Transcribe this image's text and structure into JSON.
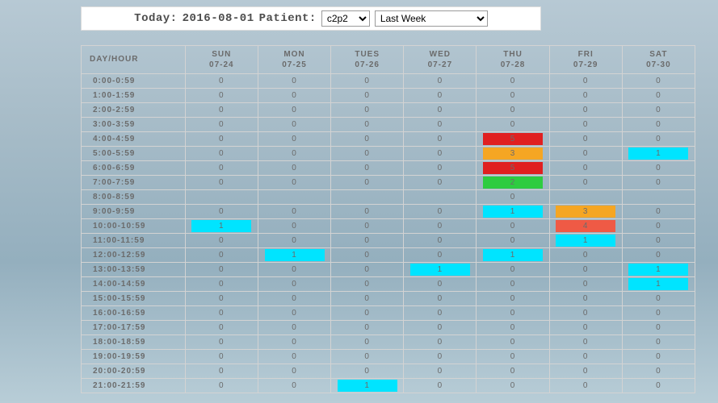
{
  "controlBar": {
    "todayLabel": "Today:",
    "todayDate": "2016-08-01",
    "patientLabel": "Patient:",
    "patientSelected": "c2p2",
    "rangeSelected": "Last Week"
  },
  "columns": {
    "hourHeader": "DAY/HOUR",
    "days": [
      {
        "name": "SUN",
        "date": "07-24"
      },
      {
        "name": "MON",
        "date": "07-25"
      },
      {
        "name": "TUES",
        "date": "07-26"
      },
      {
        "name": "WED",
        "date": "07-27"
      },
      {
        "name": "THU",
        "date": "07-28"
      },
      {
        "name": "FRI",
        "date": "07-29"
      },
      {
        "name": "SAT",
        "date": "07-30"
      }
    ]
  },
  "rows": [
    {
      "label": "0:00-0:59",
      "cells": [
        {
          "v": "0"
        },
        {
          "v": "0"
        },
        {
          "v": "0"
        },
        {
          "v": "0"
        },
        {
          "v": "0"
        },
        {
          "v": "0"
        },
        {
          "v": "0"
        }
      ]
    },
    {
      "label": "1:00-1:59",
      "cells": [
        {
          "v": "0"
        },
        {
          "v": "0"
        },
        {
          "v": "0"
        },
        {
          "v": "0"
        },
        {
          "v": "0"
        },
        {
          "v": "0"
        },
        {
          "v": "0"
        }
      ]
    },
    {
      "label": "2:00-2:59",
      "cells": [
        {
          "v": "0"
        },
        {
          "v": "0"
        },
        {
          "v": "0"
        },
        {
          "v": "0"
        },
        {
          "v": "0"
        },
        {
          "v": "0"
        },
        {
          "v": "0"
        }
      ]
    },
    {
      "label": "3:00-3:59",
      "cells": [
        {
          "v": "0"
        },
        {
          "v": "0"
        },
        {
          "v": "0"
        },
        {
          "v": "0"
        },
        {
          "v": "0"
        },
        {
          "v": "0"
        },
        {
          "v": "0"
        }
      ]
    },
    {
      "label": "4:00-4:59",
      "cells": [
        {
          "v": "0"
        },
        {
          "v": "0"
        },
        {
          "v": "0"
        },
        {
          "v": "0"
        },
        {
          "v": "5",
          "c": "red"
        },
        {
          "v": "0"
        },
        {
          "v": "0"
        }
      ]
    },
    {
      "label": "5:00-5:59",
      "cells": [
        {
          "v": "0"
        },
        {
          "v": "0"
        },
        {
          "v": "0"
        },
        {
          "v": "0"
        },
        {
          "v": "3",
          "c": "orange"
        },
        {
          "v": "0"
        },
        {
          "v": "1",
          "c": "cyan"
        }
      ]
    },
    {
      "label": "6:00-6:59",
      "cells": [
        {
          "v": "0"
        },
        {
          "v": "0"
        },
        {
          "v": "0"
        },
        {
          "v": "0"
        },
        {
          "v": "5",
          "c": "red"
        },
        {
          "v": "0"
        },
        {
          "v": "0"
        }
      ]
    },
    {
      "label": "7:00-7:59",
      "cells": [
        {
          "v": "0"
        },
        {
          "v": "0"
        },
        {
          "v": "0"
        },
        {
          "v": "0"
        },
        {
          "v": "2",
          "c": "green"
        },
        {
          "v": "0"
        },
        {
          "v": "0"
        }
      ]
    },
    {
      "label": "8:00-8:59",
      "cells": [
        {
          "v": ""
        },
        {
          "v": ""
        },
        {
          "v": ""
        },
        {
          "v": ""
        },
        {
          "v": "0"
        },
        {
          "v": ""
        },
        {
          "v": ""
        }
      ]
    },
    {
      "label": "9:00-9:59",
      "cells": [
        {
          "v": "0"
        },
        {
          "v": "0"
        },
        {
          "v": "0"
        },
        {
          "v": "0"
        },
        {
          "v": "1",
          "c": "cyan"
        },
        {
          "v": "3",
          "c": "orange"
        },
        {
          "v": "0"
        }
      ]
    },
    {
      "label": "10:00-10:59",
      "cells": [
        {
          "v": "1",
          "c": "cyan"
        },
        {
          "v": "0"
        },
        {
          "v": "0"
        },
        {
          "v": "0"
        },
        {
          "v": "0"
        },
        {
          "v": "4",
          "c": "tomato"
        },
        {
          "v": "0"
        }
      ]
    },
    {
      "label": "11:00-11:59",
      "cells": [
        {
          "v": "0"
        },
        {
          "v": "0"
        },
        {
          "v": "0"
        },
        {
          "v": "0"
        },
        {
          "v": "0"
        },
        {
          "v": "1",
          "c": "cyan"
        },
        {
          "v": "0"
        }
      ]
    },
    {
      "label": "12:00-12:59",
      "cells": [
        {
          "v": "0"
        },
        {
          "v": "1",
          "c": "cyan"
        },
        {
          "v": "0"
        },
        {
          "v": "0"
        },
        {
          "v": "1",
          "c": "cyan"
        },
        {
          "v": "0"
        },
        {
          "v": "0"
        }
      ]
    },
    {
      "label": "13:00-13:59",
      "cells": [
        {
          "v": "0"
        },
        {
          "v": "0"
        },
        {
          "v": "0"
        },
        {
          "v": "1",
          "c": "cyan"
        },
        {
          "v": "0"
        },
        {
          "v": "0"
        },
        {
          "v": "1",
          "c": "cyan"
        }
      ]
    },
    {
      "label": "14:00-14:59",
      "cells": [
        {
          "v": "0"
        },
        {
          "v": "0"
        },
        {
          "v": "0"
        },
        {
          "v": "0"
        },
        {
          "v": "0"
        },
        {
          "v": "0"
        },
        {
          "v": "1",
          "c": "cyan"
        }
      ]
    },
    {
      "label": "15:00-15:59",
      "cells": [
        {
          "v": "0"
        },
        {
          "v": "0"
        },
        {
          "v": "0"
        },
        {
          "v": "0"
        },
        {
          "v": "0"
        },
        {
          "v": "0"
        },
        {
          "v": "0"
        }
      ]
    },
    {
      "label": "16:00-16:59",
      "cells": [
        {
          "v": "0"
        },
        {
          "v": "0"
        },
        {
          "v": "0"
        },
        {
          "v": "0"
        },
        {
          "v": "0"
        },
        {
          "v": "0"
        },
        {
          "v": "0"
        }
      ]
    },
    {
      "label": "17:00-17:59",
      "cells": [
        {
          "v": "0"
        },
        {
          "v": "0"
        },
        {
          "v": "0"
        },
        {
          "v": "0"
        },
        {
          "v": "0"
        },
        {
          "v": "0"
        },
        {
          "v": "0"
        }
      ]
    },
    {
      "label": "18:00-18:59",
      "cells": [
        {
          "v": "0"
        },
        {
          "v": "0"
        },
        {
          "v": "0"
        },
        {
          "v": "0"
        },
        {
          "v": "0"
        },
        {
          "v": "0"
        },
        {
          "v": "0"
        }
      ]
    },
    {
      "label": "19:00-19:59",
      "cells": [
        {
          "v": "0"
        },
        {
          "v": "0"
        },
        {
          "v": "0"
        },
        {
          "v": "0"
        },
        {
          "v": "0"
        },
        {
          "v": "0"
        },
        {
          "v": "0"
        }
      ]
    },
    {
      "label": "20:00-20:59",
      "cells": [
        {
          "v": "0"
        },
        {
          "v": "0"
        },
        {
          "v": "0"
        },
        {
          "v": "0"
        },
        {
          "v": "0"
        },
        {
          "v": "0"
        },
        {
          "v": "0"
        }
      ]
    },
    {
      "label": "21:00-21:59",
      "cells": [
        {
          "v": "0"
        },
        {
          "v": "0"
        },
        {
          "v": "1",
          "c": "cyan"
        },
        {
          "v": "0"
        },
        {
          "v": "0"
        },
        {
          "v": "0"
        },
        {
          "v": "0"
        }
      ]
    }
  ],
  "chart_data": {
    "type": "heatmap",
    "title": "",
    "x_categories": [
      "SUN 07-24",
      "MON 07-25",
      "TUES 07-26",
      "WED 07-27",
      "THU 07-28",
      "FRI 07-29",
      "SAT 07-30"
    ],
    "y_categories": [
      "0:00-0:59",
      "1:00-1:59",
      "2:00-2:59",
      "3:00-3:59",
      "4:00-4:59",
      "5:00-5:59",
      "6:00-6:59",
      "7:00-7:59",
      "8:00-8:59",
      "9:00-9:59",
      "10:00-10:59",
      "11:00-11:59",
      "12:00-12:59",
      "13:00-13:59",
      "14:00-14:59",
      "15:00-15:59",
      "16:00-16:59",
      "17:00-17:59",
      "18:00-18:59",
      "19:00-19:59",
      "20:00-20:59",
      "21:00-21:59"
    ],
    "values": [
      [
        0,
        0,
        0,
        0,
        0,
        0,
        0
      ],
      [
        0,
        0,
        0,
        0,
        0,
        0,
        0
      ],
      [
        0,
        0,
        0,
        0,
        0,
        0,
        0
      ],
      [
        0,
        0,
        0,
        0,
        0,
        0,
        0
      ],
      [
        0,
        0,
        0,
        0,
        5,
        0,
        0
      ],
      [
        0,
        0,
        0,
        0,
        3,
        0,
        1
      ],
      [
        0,
        0,
        0,
        0,
        5,
        0,
        0
      ],
      [
        0,
        0,
        0,
        0,
        2,
        0,
        0
      ],
      [
        null,
        null,
        null,
        null,
        0,
        null,
        null
      ],
      [
        0,
        0,
        0,
        0,
        1,
        3,
        0
      ],
      [
        1,
        0,
        0,
        0,
        0,
        4,
        0
      ],
      [
        0,
        0,
        0,
        0,
        0,
        1,
        0
      ],
      [
        0,
        1,
        0,
        0,
        1,
        0,
        0
      ],
      [
        0,
        0,
        0,
        1,
        0,
        0,
        1
      ],
      [
        0,
        0,
        0,
        0,
        0,
        0,
        1
      ],
      [
        0,
        0,
        0,
        0,
        0,
        0,
        0
      ],
      [
        0,
        0,
        0,
        0,
        0,
        0,
        0
      ],
      [
        0,
        0,
        0,
        0,
        0,
        0,
        0
      ],
      [
        0,
        0,
        0,
        0,
        0,
        0,
        0
      ],
      [
        0,
        0,
        0,
        0,
        0,
        0,
        0
      ],
      [
        0,
        0,
        0,
        0,
        0,
        0,
        0
      ],
      [
        0,
        0,
        1,
        0,
        0,
        0,
        0
      ]
    ],
    "color_legend": {
      "0": "none",
      "1": "#00e4ff",
      "2": "#2ecc40",
      "3": "#f5a623",
      "4": "#ef5a45",
      "5": "#e02020"
    }
  }
}
